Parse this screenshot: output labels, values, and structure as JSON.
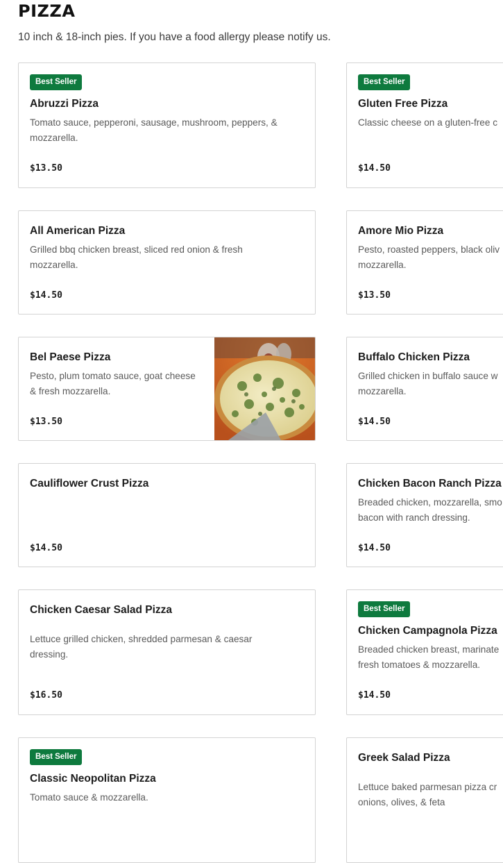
{
  "section": {
    "title": "PIZZA",
    "subtitle": "10 inch & 18-inch pies. If you have a food allergy please notify us."
  },
  "colors": {
    "badge_bg": "#0e7a3e",
    "card_border": "#d3d3d3"
  },
  "items": [
    {
      "badge": "Best Seller",
      "name": "Abruzzi Pizza",
      "desc_lines": [
        "Tomato sauce, pepperoni, sausage, mushroom, peppers, &",
        "mozzarella."
      ],
      "price": "$13.50"
    },
    {
      "badge": "Best Seller",
      "name": "Gluten Free Pizza",
      "desc_lines": [
        "Classic cheese on a gluten-free c"
      ],
      "price": "$14.50"
    },
    {
      "name": "All American Pizza",
      "desc_lines": [
        "Grilled bbq chicken breast, sliced red onion & fresh",
        "mozzarella."
      ],
      "price": "$14.50"
    },
    {
      "name": "Amore Mio Pizza",
      "desc_lines": [
        "Pesto, roasted peppers, black oliv",
        "mozzarella."
      ],
      "price": "$13.50"
    },
    {
      "name": "Bel Paese Pizza",
      "desc_lines": [
        "Pesto, plum tomato sauce, goat cheese",
        "& fresh mozzarella."
      ],
      "price": "$13.50",
      "image": "pizza-photo"
    },
    {
      "name": "Buffalo Chicken Pizza",
      "desc_lines": [
        "Grilled chicken in buffalo sauce w",
        "mozzarella."
      ],
      "price": "$14.50"
    },
    {
      "name": "Cauliflower Crust Pizza",
      "desc_lines": [],
      "price": "$14.50"
    },
    {
      "name": "Chicken Bacon Ranch Pizza",
      "desc_lines": [
        "Breaded chicken, mozzarella, smo",
        "bacon with ranch dressing."
      ],
      "price": "$14.50"
    },
    {
      "name": "Chicken Caesar Salad Pizza",
      "desc_lines": [
        "Lettuce grilled chicken, shredded parmesan & caesar",
        "dressing."
      ],
      "price": "$16.50"
    },
    {
      "badge": "Best Seller",
      "name": "Chicken Campagnola Pizza",
      "desc_lines": [
        "Breaded chicken breast, marinate",
        "fresh tomatoes & mozzarella."
      ],
      "price": "$14.50"
    },
    {
      "badge": "Best Seller",
      "name": "Classic Neopolitan Pizza",
      "desc_lines": [
        "Tomato sauce & mozzarella."
      ],
      "price": ""
    },
    {
      "name": "Greek Salad Pizza",
      "desc_lines": [
        "Lettuce baked parmesan pizza cr",
        "onions, olives, & feta"
      ],
      "price": ""
    }
  ]
}
